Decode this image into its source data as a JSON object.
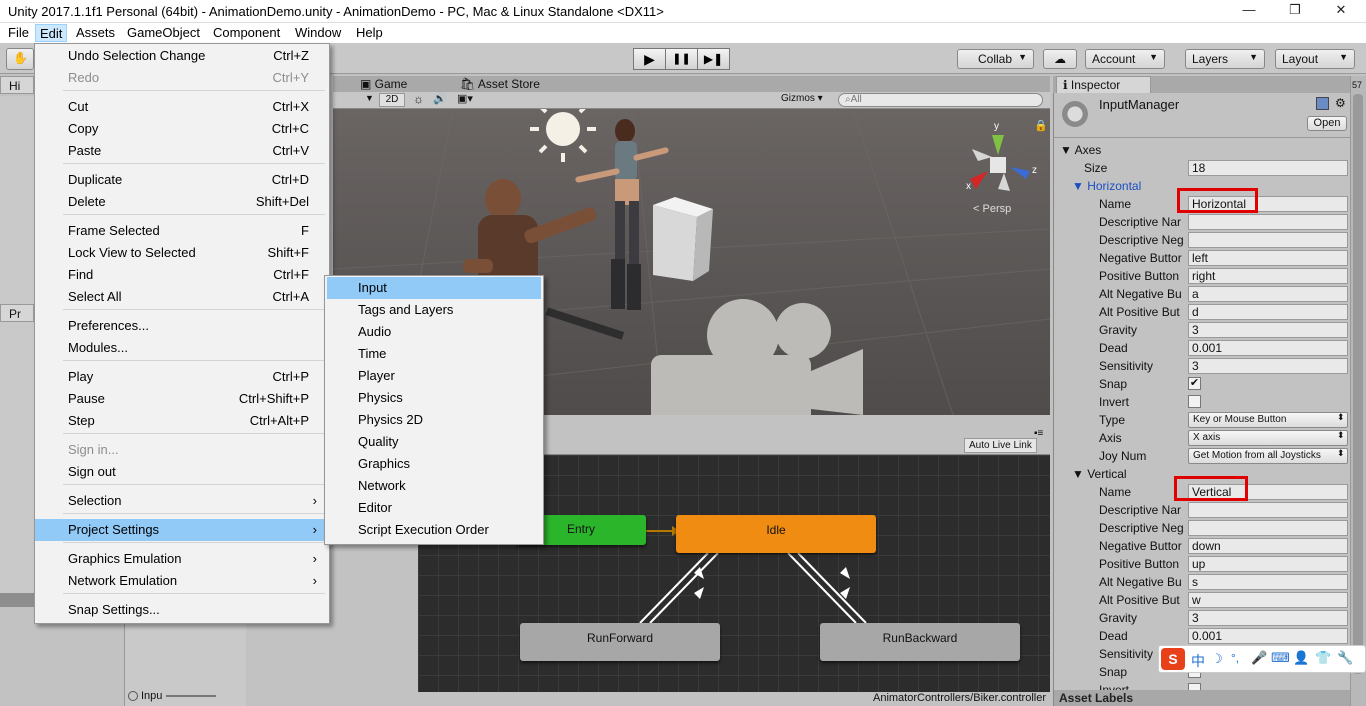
{
  "window": {
    "title": "Unity 2017.1.1f1 Personal (64bit) - AnimationDemo.unity - AnimationDemo - PC, Mac & Linux Standalone <DX11>",
    "minimize": "—",
    "restore": "❐",
    "close": "✕"
  },
  "menubar": {
    "items": [
      "File",
      "Edit",
      "Assets",
      "GameObject",
      "Component",
      "Window",
      "Help"
    ]
  },
  "toolbar": {
    "play": "▶",
    "pause": "❚❚",
    "step": "▶❚",
    "collab": "Collab",
    "cloud_icon": "cloud-icon",
    "account": "Account",
    "layers": "Layers",
    "layout": "Layout"
  },
  "tabs": {
    "game": "Game",
    "asset_store": "Asset Store",
    "inspector": "Inspector",
    "hierarchy": "Hi",
    "project": "Pr"
  },
  "scene_toolbar": {
    "mode_2d": "2D",
    "gizmos": "Gizmos",
    "search_placeholder": "All",
    "persp": "Persp"
  },
  "edit_menu": {
    "items": [
      {
        "label": "Undo Selection Change",
        "shortcut": "Ctrl+Z",
        "disabled": false
      },
      {
        "label": "Redo",
        "shortcut": "Ctrl+Y",
        "disabled": true
      },
      {
        "label": "Cut",
        "shortcut": "Ctrl+X",
        "disabled": false
      },
      {
        "label": "Copy",
        "shortcut": "Ctrl+C",
        "disabled": false
      },
      {
        "label": "Paste",
        "shortcut": "Ctrl+V",
        "disabled": false
      },
      {
        "label": "Duplicate",
        "shortcut": "Ctrl+D",
        "disabled": false
      },
      {
        "label": "Delete",
        "shortcut": "Shift+Del",
        "disabled": false
      },
      {
        "label": "Frame Selected",
        "shortcut": "F",
        "disabled": false
      },
      {
        "label": "Lock View to Selected",
        "shortcut": "Shift+F",
        "disabled": false
      },
      {
        "label": "Find",
        "shortcut": "Ctrl+F",
        "disabled": false
      },
      {
        "label": "Select All",
        "shortcut": "Ctrl+A",
        "disabled": false
      },
      {
        "label": "Preferences...",
        "shortcut": "",
        "disabled": false
      },
      {
        "label": "Modules...",
        "shortcut": "",
        "disabled": false
      },
      {
        "label": "Play",
        "shortcut": "Ctrl+P",
        "disabled": false
      },
      {
        "label": "Pause",
        "shortcut": "Ctrl+Shift+P",
        "disabled": false
      },
      {
        "label": "Step",
        "shortcut": "Ctrl+Alt+P",
        "disabled": false
      },
      {
        "label": "Sign in...",
        "shortcut": "",
        "disabled": true
      },
      {
        "label": "Sign out",
        "shortcut": "",
        "disabled": false
      },
      {
        "label": "Selection",
        "shortcut": "›",
        "disabled": false
      },
      {
        "label": "Project Settings",
        "shortcut": "›",
        "disabled": false
      },
      {
        "label": "Graphics Emulation",
        "shortcut": "›",
        "disabled": false
      },
      {
        "label": "Network Emulation",
        "shortcut": "›",
        "disabled": false
      },
      {
        "label": "Snap Settings...",
        "shortcut": "",
        "disabled": false
      }
    ]
  },
  "project_settings_menu": {
    "items": [
      "Input",
      "Tags and Layers",
      "Audio",
      "Time",
      "Player",
      "Physics",
      "Physics 2D",
      "Quality",
      "Graphics",
      "Network",
      "Editor",
      "Script Execution Order"
    ]
  },
  "animator": {
    "auto_live_link": "Auto Live Link",
    "entry": "Entry",
    "idle": "Idle",
    "run_forward": "RunForward",
    "run_backward": "RunBackward",
    "status_path": "AnimatorControllers/Biker.controller",
    "idle_color": "#f08c12",
    "entry_color": "#2ab52a"
  },
  "inspector": {
    "title": "InputManager",
    "open_button": "Open",
    "axes_label": "Axes",
    "size_label": "Size",
    "size_value": "18",
    "horizontal": {
      "header": "Horizontal",
      "rows": [
        {
          "label": "Name",
          "value": "Horizontal",
          "type": "text"
        },
        {
          "label": "Descriptive Nar",
          "value": "",
          "type": "text"
        },
        {
          "label": "Descriptive Neg",
          "value": "",
          "type": "text"
        },
        {
          "label": "Negative Buttor",
          "value": "left",
          "type": "text"
        },
        {
          "label": "Positive Button",
          "value": "right",
          "type": "text"
        },
        {
          "label": "Alt Negative Bu",
          "value": "a",
          "type": "text"
        },
        {
          "label": "Alt Positive But",
          "value": "d",
          "type": "text"
        },
        {
          "label": "Gravity",
          "value": "3",
          "type": "text"
        },
        {
          "label": "Dead",
          "value": "0.001",
          "type": "text"
        },
        {
          "label": "Sensitivity",
          "value": "3",
          "type": "text"
        },
        {
          "label": "Snap",
          "value": "✔",
          "type": "check"
        },
        {
          "label": "Invert",
          "value": "",
          "type": "check"
        },
        {
          "label": "Type",
          "value": "Key or Mouse Button",
          "type": "dropdown"
        },
        {
          "label": "Axis",
          "value": "X axis",
          "type": "dropdown"
        },
        {
          "label": "Joy Num",
          "value": "Get Motion from all Joysticks",
          "type": "dropdown"
        }
      ]
    },
    "vertical": {
      "header": "Vertical",
      "rows": [
        {
          "label": "Name",
          "value": "Vertical",
          "type": "text"
        },
        {
          "label": "Descriptive Nar",
          "value": "",
          "type": "text"
        },
        {
          "label": "Descriptive Neg",
          "value": "",
          "type": "text"
        },
        {
          "label": "Negative Buttor",
          "value": "down",
          "type": "text"
        },
        {
          "label": "Positive Button",
          "value": "up",
          "type": "text"
        },
        {
          "label": "Alt Negative Bu",
          "value": "s",
          "type": "text"
        },
        {
          "label": "Alt Positive But",
          "value": "w",
          "type": "text"
        },
        {
          "label": "Gravity",
          "value": "3",
          "type": "text"
        },
        {
          "label": "Dead",
          "value": "0.001",
          "type": "text"
        },
        {
          "label": "Sensitivity",
          "value": "3",
          "type": "text"
        },
        {
          "label": "Snap",
          "value": "✔",
          "type": "check"
        },
        {
          "label": "Invert",
          "value": "",
          "type": "check"
        }
      ]
    },
    "asset_labels": "Asset Labels"
  },
  "bottom_left": {
    "input_label": "Inpu"
  },
  "ime_bar": {
    "items": [
      "S",
      "中",
      "☽",
      "°,",
      "🎤",
      "⌨",
      "👤",
      "👕",
      "🔧"
    ]
  },
  "scrollbar_badge": "57"
}
